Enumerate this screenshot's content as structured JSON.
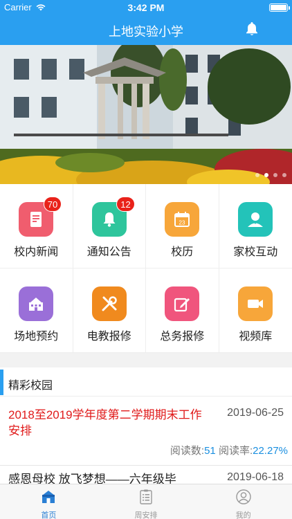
{
  "status": {
    "carrier": "Carrier",
    "time": "3:42 PM"
  },
  "header": {
    "title": "上地实验小学"
  },
  "banner": {
    "slides": 4,
    "active": 2
  },
  "menu": [
    {
      "label": "校内新闻",
      "icon": "news-icon",
      "color": "#f05d6e",
      "badge": "70"
    },
    {
      "label": "通知公告",
      "icon": "bell-icon",
      "color": "#2ec59c",
      "badge": "12"
    },
    {
      "label": "校历",
      "icon": "calendar-icon",
      "color": "#f7a63a",
      "badge": ""
    },
    {
      "label": "家校互动",
      "icon": "person-icon",
      "color": "#23c3b9",
      "badge": ""
    },
    {
      "label": "场地预约",
      "icon": "building-icon",
      "color": "#9a6fd8",
      "badge": ""
    },
    {
      "label": "电教报修",
      "icon": "tools-icon",
      "color": "#f08a1e",
      "badge": ""
    },
    {
      "label": "总务报修",
      "icon": "edit-icon",
      "color": "#f0557d",
      "badge": ""
    },
    {
      "label": "视频库",
      "icon": "video-icon",
      "color": "#f7a63a",
      "badge": ""
    }
  ],
  "section": {
    "title": "精彩校园",
    "news": [
      {
        "title": "2018至2019学年度第二学期期末工作安排",
        "date": "2019-06-25",
        "reads_label": "阅读数:",
        "reads": "51",
        "rate_label": "阅读率:",
        "rate": "22.27%"
      },
      {
        "title": "感恩母校 放飞梦想——六年级毕",
        "date": "2019-06-18"
      }
    ]
  },
  "tabs": [
    {
      "label": "首页",
      "icon": "home-icon",
      "active": true
    },
    {
      "label": "周安排",
      "icon": "list-icon",
      "active": false
    },
    {
      "label": "我的",
      "icon": "profile-icon",
      "active": false
    }
  ],
  "colors": {
    "primary": "#2a9ff0",
    "accent_red": "#e01a1a",
    "link_blue": "#1a8fe0"
  }
}
